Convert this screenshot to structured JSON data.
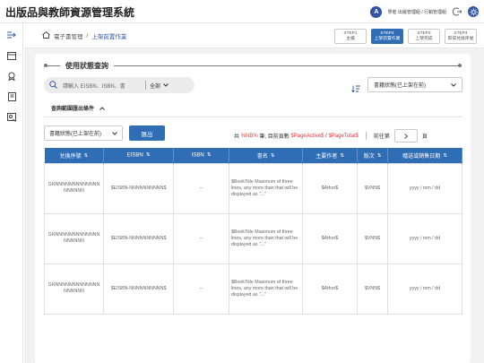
{
  "app": {
    "title": "出版品與教師資源管理系統",
    "user_initial": "A",
    "user_label": "學者  出版管理組 / 行銷管理組",
    "icons": [
      "logout-icon",
      "settings-icon"
    ]
  },
  "sidebar": {
    "items": [
      {
        "icon": "expand-icon"
      },
      {
        "icon": "window-icon"
      },
      {
        "icon": "award-icon"
      },
      {
        "icon": "book-icon"
      },
      {
        "icon": "user-badge-icon"
      }
    ]
  },
  "breadcrumb": {
    "home_icon": "home-icon",
    "items": [
      "電子書管理",
      "上架前置作業"
    ],
    "sep": "/"
  },
  "steps": [
    {
      "title": "STEP1",
      "sub": "主檔",
      "active": false
    },
    {
      "title": "STEP2",
      "sub": "上架前置作業",
      "active": true
    },
    {
      "title": "STEP3",
      "sub": "上架完成",
      "active": false
    },
    {
      "title": "STEP4",
      "sub": "取得兌換序號",
      "active": false
    }
  ],
  "section": {
    "title": "使用狀態查詢"
  },
  "search": {
    "placeholder": "請輸入 EISBN、ISBN、書",
    "scope": "全部"
  },
  "top_select": {
    "value": "書籍狀態(已上架在前)"
  },
  "filter": {
    "label": "查詢範圍匯出條件"
  },
  "sub_select": {
    "value": "書籍狀態(已上架在前)"
  },
  "export_button": "匯出",
  "counts": {
    "prefix": "共",
    "total": "%NB%",
    "mid": "筆, 目前頁數",
    "active": "$PageActive$",
    "slash": "/",
    "page_total": "$PageTotal$",
    "goto": "前往第",
    "page_unit": "頁"
  },
  "table": {
    "headers": [
      "兌換序號",
      "EISBN",
      "ISBN",
      "書名",
      "主要作者",
      "版次",
      "贈送或銷售日期"
    ],
    "sortable": [
      true,
      true,
      true,
      true,
      true,
      true,
      true
    ],
    "rows": [
      [
        "GNNNNNNNNNNNNNNNNNNNN",
        "$EISBN-NNNNNNNNNN$",
        "--",
        "$BookTitle Maximum of three lines, any more than that will be displayed as \"...\"",
        "$Athor$",
        "$VNN$",
        "yyyy / mm / dd"
      ],
      [
        "GNNNNNNNNNNNNNNNNNNNN",
        "$EISBN-NNNNNNNNNN$",
        "--",
        "$BookTitle Maximum of three lines, any more than that will be displayed as \"...\"",
        "$Athor$",
        "$VNN$",
        "yyyy / mm / dd"
      ],
      [
        "GNNNNNNNNNNNNNNNNNNNN",
        "$EISBN-NNNNNNNNNN$",
        "--",
        "$BookTitle Maximum of three lines, any more than that will be displayed as \"...\"",
        "$Athor$",
        "$VNN$",
        "yyyy / mm / dd"
      ]
    ]
  },
  "colors": {
    "accent": "#2f6db5",
    "brand": "#2f55a4",
    "highlight": "#e0393e"
  }
}
